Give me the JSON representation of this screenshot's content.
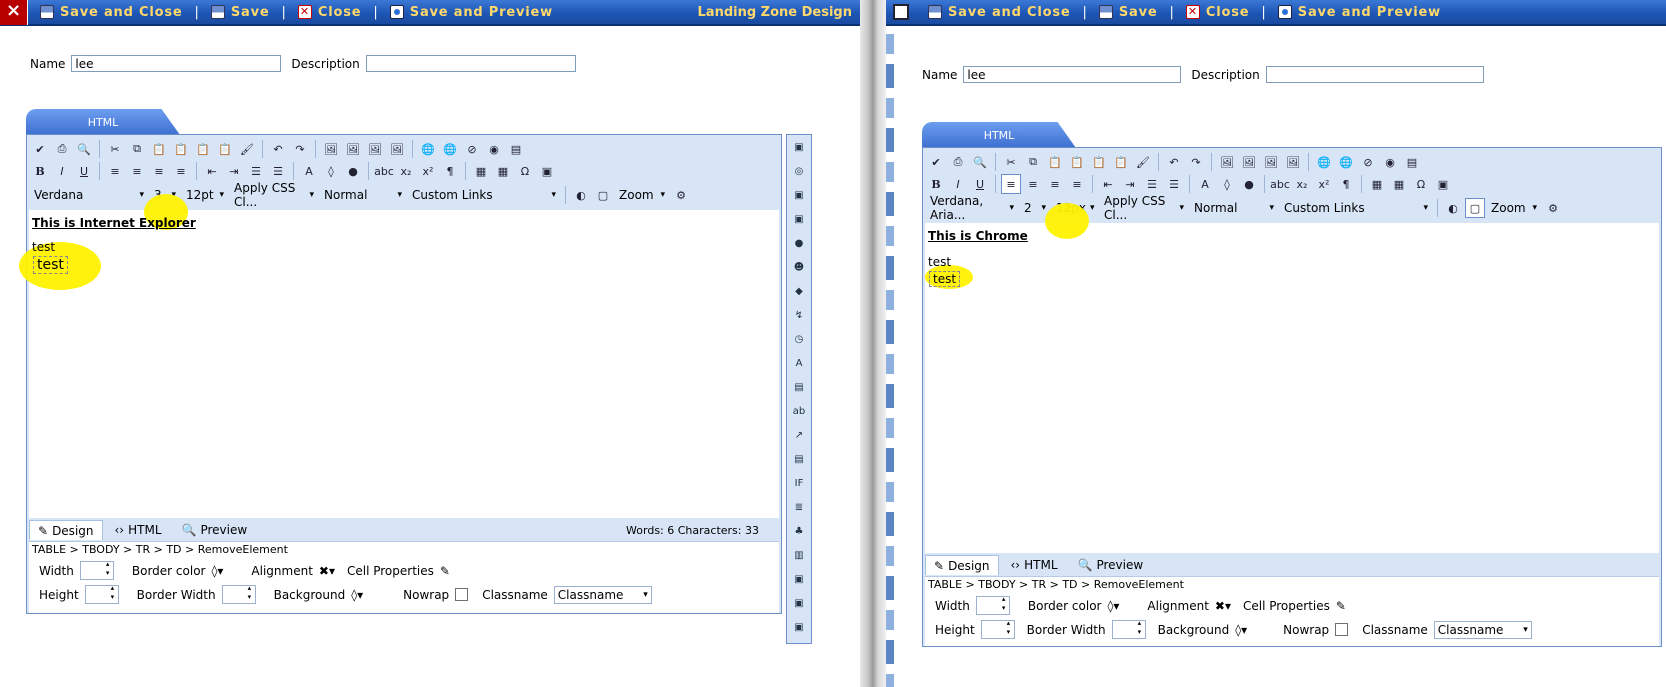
{
  "left": {
    "toolbar": {
      "save_close": "Save and Close",
      "save": "Save",
      "close": "Close",
      "save_preview": "Save and Preview",
      "title": "Landing Zone Design"
    },
    "name_label": "Name",
    "name_value": "lee",
    "desc_label": "Description",
    "desc_value": "",
    "tab": "HTML",
    "font": "Verdana",
    "size": "3",
    "fontsize": "12pt",
    "css": "Apply CSS Cl...",
    "para": "Normal",
    "links": "Custom Links",
    "zoom": "Zoom",
    "heading": "This is Internet Explorer",
    "text1": "test",
    "text2": "test",
    "modes": {
      "design": "Design",
      "html": "HTML",
      "preview": "Preview"
    },
    "stats": "Words: 6   Characters: 33",
    "path": "TABLE > TBODY > TR > TD > RemoveElement",
    "props": {
      "width": "Width",
      "height": "Height",
      "border_color": "Border color",
      "border_width": "Border Width",
      "alignment": "Alignment",
      "background": "Background",
      "cell_props": "Cell Properties",
      "nowrap": "Nowrap",
      "classname": "Classname",
      "classname_val": "Classname"
    }
  },
  "right": {
    "toolbar": {
      "save_close": "Save and Close",
      "save": "Save",
      "close": "Close",
      "save_preview": "Save and Preview"
    },
    "name_label": "Name",
    "name_value": "lee",
    "desc_label": "Description",
    "desc_value": "",
    "tab": "HTML",
    "font": "Verdana, Aria...",
    "size": "2",
    "fontsize": "12px",
    "css": "Apply CSS Cl...",
    "para": "Normal",
    "links": "Custom Links",
    "zoom": "Zoom",
    "heading": "This is Chrome",
    "text1": "test",
    "text2": "test",
    "modes": {
      "design": "Design",
      "html": "HTML",
      "preview": "Preview"
    },
    "path": "TABLE > TBODY > TR > TD > RemoveElement",
    "props": {
      "width": "Width",
      "height": "Height",
      "border_color": "Border color",
      "border_width": "Border Width",
      "alignment": "Alignment",
      "background": "Background",
      "cell_props": "Cell Properties",
      "nowrap": "Nowrap",
      "classname": "Classname",
      "classname_val": "Classname"
    }
  },
  "colors": {
    "toolbar": "#1e56b4",
    "toolbar_text": "#ffd86b",
    "editor_bg": "#d7e5f7",
    "highlight": "#fff200"
  }
}
